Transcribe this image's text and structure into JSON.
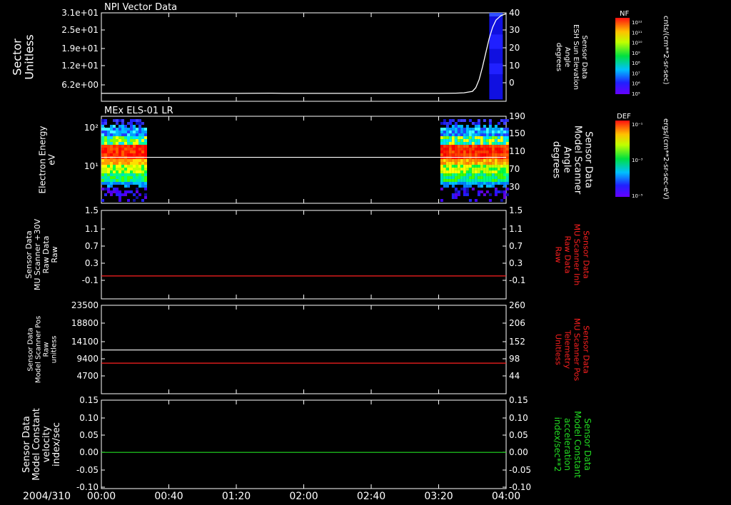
{
  "date_label": "2004/310",
  "time_ticks": [
    "00:00",
    "00:40",
    "01:20",
    "02:00",
    "02:40",
    "03:20",
    "04:00"
  ],
  "colors": {
    "white": "#ffffff",
    "red": "#ff2020",
    "green": "#22dd22",
    "background": "#000000"
  },
  "colorbars": [
    {
      "title": "NF",
      "units": "cnts/(cm**2-sr-sec)",
      "tick_labels": [
        "10¹²",
        "10¹¹",
        "10¹⁰",
        "10⁹",
        "10⁸",
        "10⁷",
        "10⁶",
        "10⁵"
      ]
    },
    {
      "title": "DEF",
      "units": "ergs/(cm**2-sr-sec-eV)",
      "tick_labels": [
        "10⁻¹",
        "10⁻³",
        "10⁻⁵"
      ]
    }
  ],
  "chart_data": [
    {
      "type": "line",
      "title": "NPI Vector Data",
      "ylabel": [
        "Sector",
        "Unitless"
      ],
      "yticks": [
        "3.1e+01",
        "2.5e+01",
        "1.9e+01",
        "1.2e+01",
        "6.2e+00"
      ],
      "ylabel_right": [
        "Sensor Data",
        "ESH Sun Elevation",
        "Angle",
        "degrees"
      ],
      "yticks_right": [
        "40",
        "30",
        "20",
        "10",
        "0"
      ],
      "series": [
        {
          "color": "#ffffff",
          "axis": "right",
          "points": [
            [
              0,
              -4.6
            ],
            [
              80,
              -4.6
            ],
            [
              100,
              -4.5
            ],
            [
              108,
              -4.6
            ],
            [
              200,
              -4.6
            ],
            [
              210,
              -4.5
            ],
            [
              215,
              -4.3
            ],
            [
              220,
              -3.5
            ],
            [
              222,
              -1.5
            ],
            [
              224,
              3
            ],
            [
              226,
              10
            ],
            [
              228,
              18
            ],
            [
              230,
              26
            ],
            [
              232,
              32
            ],
            [
              234,
              36
            ],
            [
              237,
              38.5
            ],
            [
              240,
              39.5
            ]
          ]
        }
      ],
      "spectrogram": {
        "x_start": 230,
        "x_end": 238,
        "blocks": [
          {
            "from": -8,
            "to": 38,
            "color": "#1010e0"
          },
          {
            "from": 38,
            "to": 40,
            "color": "#3050ff"
          },
          {
            "from": 28,
            "to": 20,
            "color": "#2020ff"
          },
          {
            "from": 12,
            "to": 6,
            "color": "#2020ff"
          }
        ]
      }
    },
    {
      "type": "heatmap",
      "title": "MEx ELS-01 LR",
      "ylabel": [
        "Electron Energy",
        "eV"
      ],
      "yticks": [
        "10²",
        "10¹"
      ],
      "ylabel_right": [
        "Sensor Data",
        "Model Scanner",
        "Angle",
        "degrees"
      ],
      "yticks_right": [
        "190",
        "150",
        "110",
        "70",
        "30"
      ],
      "scanner_angle_line": 97,
      "bursts": [
        {
          "start": 0,
          "end": 27
        },
        {
          "start": 201,
          "end": 240
        }
      ]
    },
    {
      "type": "line",
      "ylabel": [
        "Sensor Data",
        "MU Scanner +30V",
        "Raw Data",
        "Raw"
      ],
      "yticks": [
        "1.5",
        "1.1",
        "0.7",
        "0.3",
        "-0.1"
      ],
      "ylabel_right": [
        "Sensor Data",
        "MU Scanner Inh",
        "Raw Data",
        "Raw"
      ],
      "yticks_right": [
        "1.5",
        "1.1",
        "0.7",
        "0.3",
        "-0.1"
      ],
      "ylim": [
        -0.3,
        1.5
      ],
      "series": [
        {
          "color": "#ff2020",
          "points": [
            [
              0,
              0.0
            ],
            [
              240,
              0.0
            ]
          ]
        }
      ]
    },
    {
      "type": "line",
      "ylabel": [
        "Sensor Data",
        "Model Scanner Pos",
        "Raw",
        "unitless"
      ],
      "yticks": [
        "23500",
        "18800",
        "14100",
        "9400",
        "4700"
      ],
      "ylabel_right": [
        "Sensor Data",
        "MU Scanner Pos",
        "Telemetry",
        "Unitless"
      ],
      "yticks_right": [
        "260",
        "206",
        "152",
        "98",
        "44"
      ],
      "ylim": [
        0,
        23500
      ],
      "ylim_right": [
        0,
        260
      ],
      "series": [
        {
          "color": "#ffffff",
          "axis": "left",
          "points": [
            [
              0,
              11600
            ],
            [
              240,
              11600
            ]
          ]
        },
        {
          "color": "#ff2020",
          "axis": "left",
          "points": [
            [
              0,
              8100
            ],
            [
              240,
              8100
            ]
          ]
        }
      ]
    },
    {
      "type": "line",
      "ylabel": [
        "Sensor Data",
        "Model Constant",
        "velocity",
        "index/sec"
      ],
      "yticks": [
        "0.15",
        "0.10",
        "0.05",
        "0.00",
        "-0.05",
        "-0.10"
      ],
      "ylabel_right": [
        "Sensor Data",
        "Model Constant",
        "acceleration",
        "index/sec**2"
      ],
      "yticks_right": [
        "0.15",
        "0.10",
        "0.05",
        "0.00",
        "-0.05",
        "-0.10"
      ],
      "ylim": [
        -0.1,
        0.15
      ],
      "series": [
        {
          "color": "#22dd22",
          "points": [
            [
              0,
              0.0
            ],
            [
              240,
              0.0
            ]
          ]
        }
      ]
    }
  ]
}
